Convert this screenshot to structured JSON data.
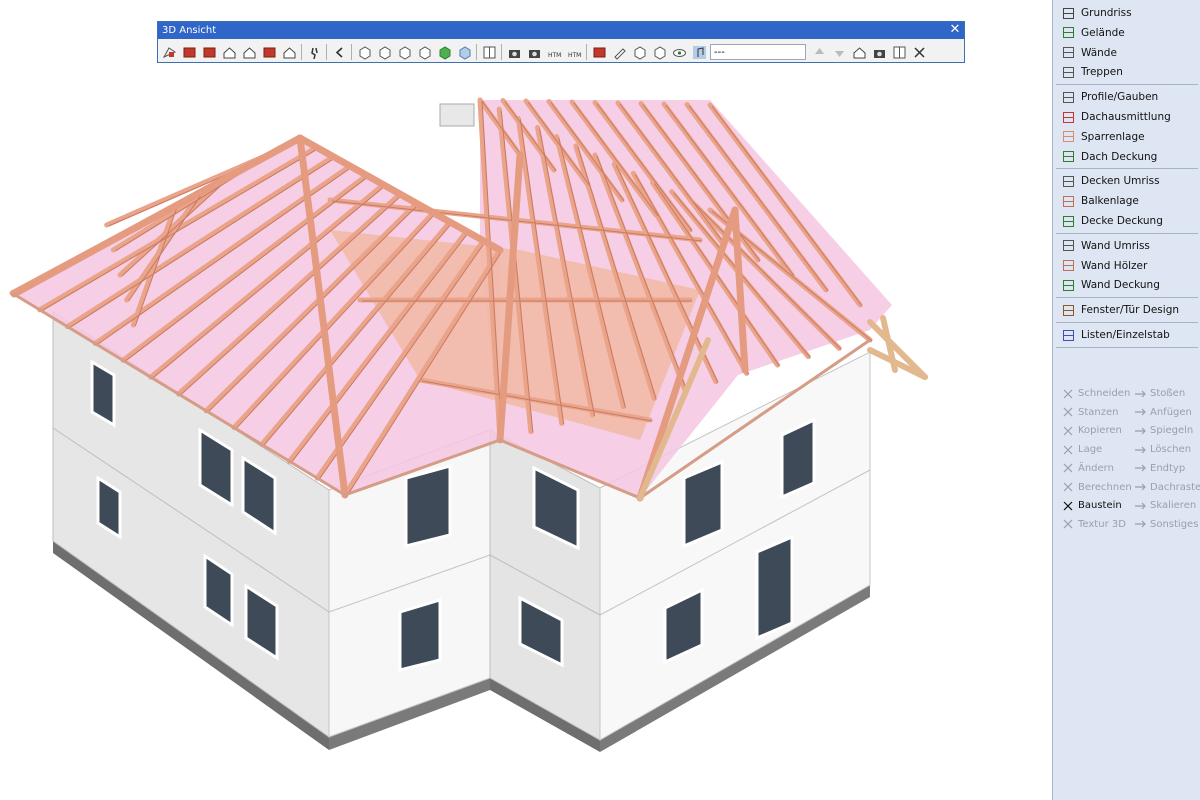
{
  "toolbar": {
    "title": "3D Ansicht",
    "close_glyph": "✕",
    "view_select_value": "---",
    "buttons": [
      "perspective-icon",
      "north-view-icon",
      "south-view-icon",
      "house-view-icon",
      "house-view-2-icon",
      "red-block-icon",
      "house-front-icon",
      "walk-icon",
      "step-back-icon",
      "cube-wire-icon",
      "cube-wire-2-icon",
      "cube-wire-3-icon",
      "cube-open-icon",
      "cube-green-icon",
      "cube-shaded-icon",
      "camera-settings-icon",
      "camera-icon",
      "camera-2-icon",
      "html-export-icon",
      "html-export-2-icon",
      "dach-red-icon",
      "pen-icon",
      "cube-layers-icon",
      "stack-menu-icon",
      "eye-menu-icon",
      "music-icon",
      "arrow-up-icon",
      "arrow-down-icon",
      "house-edit-icon",
      "camera-house-icon",
      "window-icon",
      "close-window-icon"
    ]
  },
  "panel": {
    "groups": [
      [
        "Grundriss",
        "Gelände",
        "Wände",
        "Treppen"
      ],
      [
        "Profile/Gauben",
        "Dachausmittlung",
        "Sparrenlage",
        "Dach Deckung"
      ],
      [
        "Decken Umriss",
        "Balkenlage",
        "Decke Deckung"
      ],
      [
        "Wand Umriss",
        "Wand Hölzer",
        "Wand Deckung"
      ],
      [
        "Fenster/Tür Design"
      ],
      [
        "Listen/Einzelstab"
      ]
    ],
    "tools_left": [
      "Schneiden",
      "Stanzen",
      "Kopieren",
      "Lage",
      "Ändern",
      "Berechnen",
      "Baustein",
      "Textur 3D"
    ],
    "tools_right": [
      "Stoßen",
      "Anfügen",
      "Spiegeln",
      "Löschen",
      "Endtyp",
      "Dachraster",
      "Skalieren",
      "Sonstiges"
    ],
    "active_tool": "Baustein"
  },
  "colors": {
    "title_bar": "#2f66c7",
    "panel_bg": "#dfe6f3",
    "wall": "#ededed",
    "roof_timber": "#f2b89f",
    "roof_glass": "#f3c6e4"
  }
}
